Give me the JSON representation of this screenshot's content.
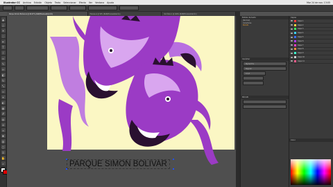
{
  "menubar": {
    "app": "Illustrator CC",
    "items": [
      "Archivo",
      "Edición",
      "Objeto",
      "Texto",
      "Seleccionar",
      "Efecto",
      "Ver",
      "Ventana",
      "Ayuda"
    ],
    "clock": "Mar 24 de nov. 13:05"
  },
  "tabs": [
    {
      "label": "Parque Simón Bolívar.ai @ 66.67% (RGB/Previsualización)"
    },
    {
      "label": "Hienas.ai @ 50% (RGB/Previsualización)"
    },
    {
      "label": "Sin título-1 @ 100% (RGB/Previsualización)"
    }
  ],
  "canvas": {
    "caption": "PARQUE SIMON BOLIVAR",
    "artboard_color": "#fbf7c4",
    "art_colors": {
      "purple": "#9b3bc5",
      "light_purple": "#d9a6ef",
      "dark": "#2a1030",
      "highlight": "#ffffff"
    }
  },
  "middle_panel": {
    "header": "Estilos de texto",
    "rows": [
      "[Normal]",
      "Caracteres",
      "Párrafo"
    ],
    "props_header": "Carácter",
    "font": "Myriad Pro",
    "style": "Regular",
    "size": "12 pt",
    "paragraph_header": "Párrafo"
  },
  "right_panel": {
    "header": "Capas",
    "layers": [
      "Capa 1",
      "Capa 2",
      "Capa 3",
      "Capa 4",
      "Capa 5",
      "Capa 6",
      "Capa 7",
      "Capa 8",
      "Capa 9",
      "Capa 10",
      "Capa 11"
    ],
    "swatch_colors": [
      "#ff3b3b",
      "#ffd43b",
      "#3bff5a",
      "#3bd3ff",
      "#3b6bff",
      "#b03bff",
      "#ff3bd0",
      "#ff8a3b",
      "#3bffd0",
      "#d0d0d0",
      "#ff5a8a"
    ],
    "color_header": "Color"
  }
}
